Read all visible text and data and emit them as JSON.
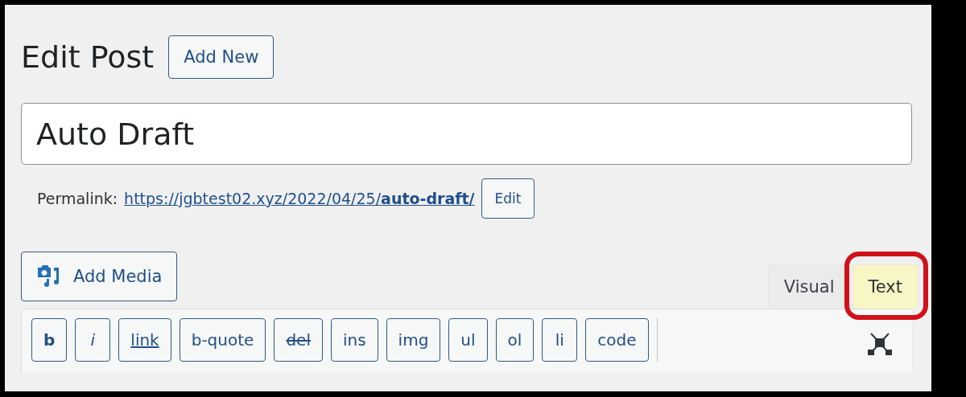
{
  "heading": {
    "title": "Edit Post",
    "add_new": "Add New"
  },
  "title_field": {
    "value": "Auto Draft"
  },
  "permalink": {
    "label": "Permalink:",
    "url": "https://jgbtest02.xyz/2022/04/25/**auto-draft/**",
    "edit": "Edit"
  },
  "add_media": "Add Media",
  "editor_tabs": [
    {
      "label": "Visual",
      "selected": false,
      "highlighted": false
    },
    {
      "label": "Text",
      "selected": true,
      "highlighted": true
    }
  ],
  "quicktags": [
    {
      "label": "b",
      "kind": "bold"
    },
    {
      "label": "i",
      "kind": "italic"
    },
    {
      "label": "link",
      "kind": "link"
    },
    {
      "label": "b-quote",
      "kind": "plain"
    },
    {
      "label": "del",
      "kind": "del"
    },
    {
      "label": "ins",
      "kind": "plain"
    },
    {
      "label": "img",
      "kind": "plain"
    },
    {
      "label": "ul",
      "kind": "plain"
    },
    {
      "label": "ol",
      "kind": "plain"
    },
    {
      "label": "li",
      "kind": "plain"
    },
    {
      "label": "code",
      "kind": "plain"
    }
  ]
}
